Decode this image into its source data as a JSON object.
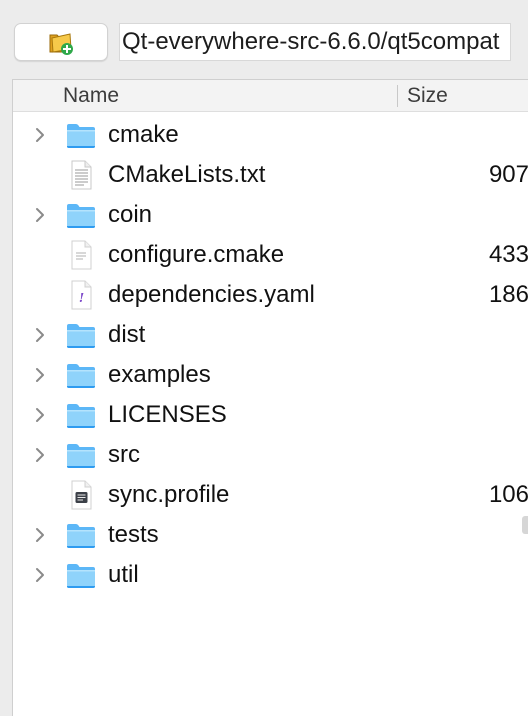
{
  "toolbar": {
    "new_folder_icon": "new-folder-icon",
    "path": "Qt-everywhere-src-6.6.0/qt5compat"
  },
  "columns": {
    "name": "Name",
    "size": "Size"
  },
  "files": [
    {
      "name": "cmake",
      "size": "",
      "kind": "folder",
      "expandable": true
    },
    {
      "name": "CMakeLists.txt",
      "size": "907",
      "kind": "text-document",
      "expandable": false
    },
    {
      "name": "coin",
      "size": "",
      "kind": "folder",
      "expandable": true
    },
    {
      "name": "configure.cmake",
      "size": "433",
      "kind": "plain-document",
      "expandable": false
    },
    {
      "name": "dependencies.yaml",
      "size": "186",
      "kind": "yaml-document",
      "expandable": false
    },
    {
      "name": "dist",
      "size": "",
      "kind": "folder",
      "expandable": true
    },
    {
      "name": "examples",
      "size": "",
      "kind": "folder",
      "expandable": true
    },
    {
      "name": "LICENSES",
      "size": "",
      "kind": "folder",
      "expandable": true
    },
    {
      "name": "src",
      "size": "",
      "kind": "folder",
      "expandable": true
    },
    {
      "name": "sync.profile",
      "size": "106",
      "kind": "script-document",
      "expandable": false
    },
    {
      "name": "tests",
      "size": "",
      "kind": "folder",
      "expandable": true
    },
    {
      "name": "util",
      "size": "",
      "kind": "folder",
      "expandable": true
    }
  ],
  "colors": {
    "folder_light": "#8fd3fb",
    "folder_dark": "#2e9bf0",
    "background": "#ececec"
  }
}
